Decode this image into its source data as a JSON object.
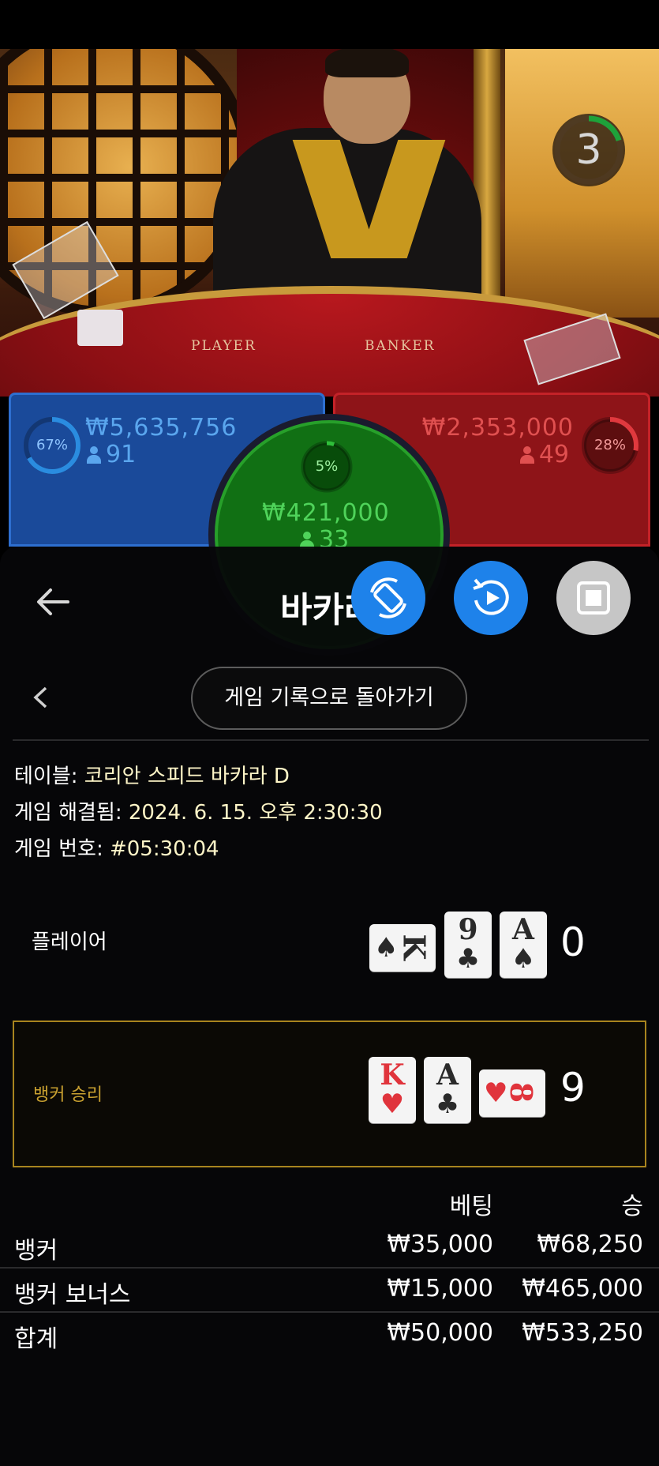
{
  "video": {
    "timer_value": "3",
    "table_player_text": "PLAYER",
    "table_banker_text": "BANKER",
    "timer_fraction": 0.2
  },
  "bets": {
    "player": {
      "percent": "67%",
      "percent_value": 0.67,
      "amount": "₩5,635,756",
      "players": "91"
    },
    "banker": {
      "percent": "28%",
      "percent_value": 0.28,
      "amount": "₩2,353,000",
      "players": "49"
    },
    "tie": {
      "percent": "5%",
      "percent_value": 0.05,
      "amount": "₩421,000",
      "players": "33"
    }
  },
  "sheet": {
    "title": "바카라",
    "back_label": "게임 기록으로 돌아가기",
    "info": {
      "table_label": "테이블:",
      "table_value": "코리안 스피드 바카라 D",
      "resolved_label": "게임 해결됨:",
      "resolved_value": "2024. 6. 15. 오후 2:30:30",
      "number_label": "게임 번호:",
      "number_value": "#05:30:04"
    },
    "player_row": {
      "label": "플레이어",
      "score": "0",
      "cards": [
        {
          "rank": "K",
          "suit": "spade",
          "color": "black",
          "rotated": true
        },
        {
          "rank": "9",
          "suit": "club",
          "color": "black",
          "rotated": false
        },
        {
          "rank": "A",
          "suit": "spade",
          "color": "black",
          "rotated": false
        }
      ]
    },
    "banker_row": {
      "label": "뱅커 승리",
      "score": "9",
      "cards": [
        {
          "rank": "K",
          "suit": "heart",
          "color": "red",
          "rotated": false
        },
        {
          "rank": "A",
          "suit": "club",
          "color": "black",
          "rotated": false
        },
        {
          "rank": "8",
          "suit": "heart",
          "color": "red",
          "rotated": true
        }
      ]
    },
    "table": {
      "header_bet": "베팅",
      "header_win": "승",
      "rows": [
        {
          "name": "뱅커",
          "bet": "₩35,000",
          "win": "₩68,250"
        },
        {
          "name": "뱅커 보너스",
          "bet": "₩15,000",
          "win": "₩465,000"
        },
        {
          "name": "합계",
          "bet": "₩50,000",
          "win": "₩533,250"
        }
      ]
    }
  },
  "colors": {
    "player_blue": "#1a4a9a",
    "banker_red": "#8e1418",
    "tie_green": "#117014",
    "winner_gold": "#a8841e",
    "control_blue": "#1e82ea"
  }
}
